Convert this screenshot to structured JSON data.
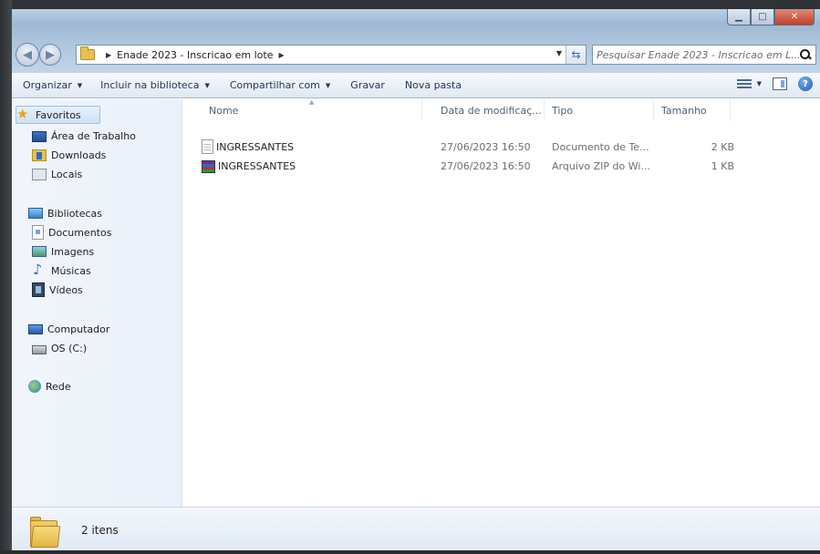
{
  "window": {
    "caption_buttons": [
      "minimize",
      "maximize",
      "close"
    ]
  },
  "address": {
    "breadcrumb": [
      "Enade 2023 - Inscricao em lote"
    ],
    "search_placeholder": "Pesquisar Enade 2023 - Inscricao em L..."
  },
  "toolbar": {
    "organize": "Organizar",
    "include_library": "Incluir na biblioteca",
    "share_with": "Compartilhar com",
    "burn": "Gravar",
    "new_folder": "Nova pasta"
  },
  "sidebar": {
    "favorites": {
      "label": "Favoritos",
      "items": [
        {
          "label": "Área de Trabalho",
          "icon": "desktop-icon"
        },
        {
          "label": "Downloads",
          "icon": "downloads-icon"
        },
        {
          "label": "Locais",
          "icon": "recent-places-icon"
        }
      ]
    },
    "libraries": {
      "label": "Bibliotecas",
      "items": [
        {
          "label": "Documentos",
          "icon": "documents-icon"
        },
        {
          "label": "Imagens",
          "icon": "pictures-icon"
        },
        {
          "label": "Músicas",
          "icon": "music-icon"
        },
        {
          "label": "Vídeos",
          "icon": "videos-icon"
        }
      ]
    },
    "computer": {
      "label": "Computador",
      "items": [
        {
          "label": "OS (C:)",
          "icon": "drive-icon"
        }
      ]
    },
    "network": {
      "label": "Rede"
    }
  },
  "file_list": {
    "columns": [
      "Nome",
      "Data de modificaç...",
      "Tipo",
      "Tamanho"
    ],
    "rows": [
      {
        "name": "INGRESSANTES",
        "date": "27/06/2023 16:50",
        "type": "Documento de Te...",
        "size": "2 KB",
        "icon": "text-file-icon"
      },
      {
        "name": "INGRESSANTES",
        "date": "27/06/2023 16:50",
        "type": "Arquivo ZIP do Wi...",
        "size": "1 KB",
        "icon": "winrar-archive-icon"
      }
    ]
  },
  "details": {
    "item_count": "2 itens"
  },
  "colors": {
    "selection": "#cfe1f6",
    "toolbar_text": "#1e395b",
    "muted_text": "#6d6d6d"
  }
}
